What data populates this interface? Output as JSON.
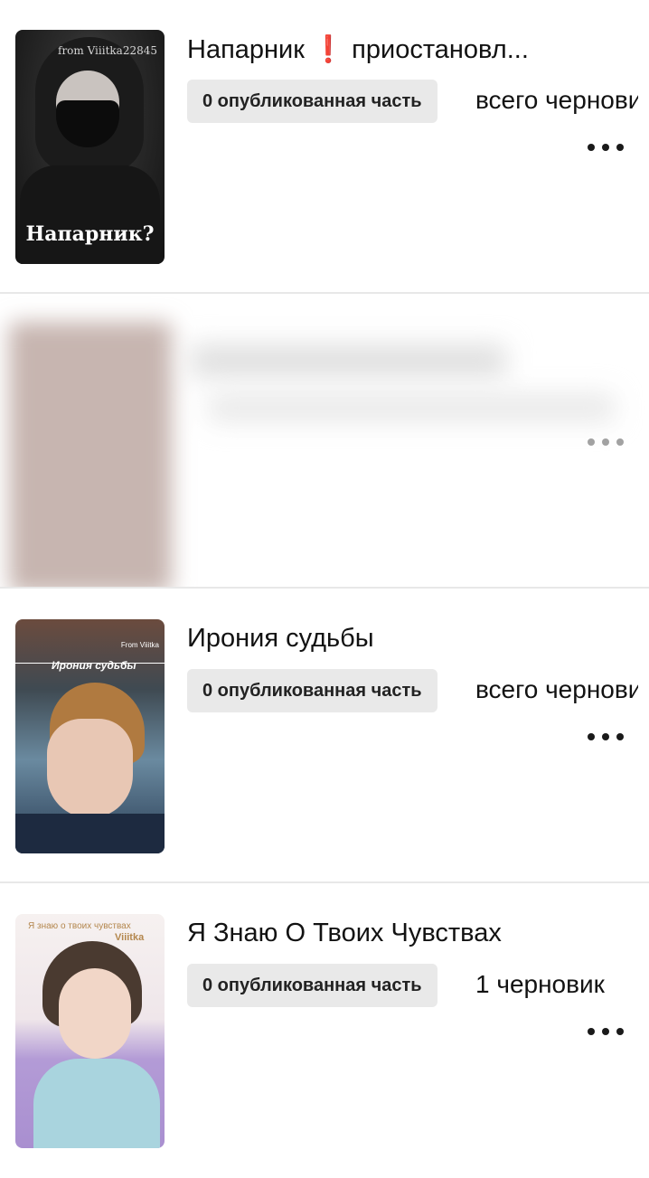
{
  "stories": [
    {
      "title": "Напарник ❗️ приостановл...",
      "published_badge": "0 опубликованная часть",
      "drafts": "всего черновиков",
      "cover": {
        "watermark": "from Viiitka22845",
        "caption": "Напарник?"
      }
    },
    {
      "blurred": true
    },
    {
      "title": "Ирония судьбы",
      "published_badge": "0 опубликованная часть",
      "drafts": "всего черновиков",
      "cover": {
        "watermark": "From Viiitka",
        "caption": "Ирония судьбы"
      }
    },
    {
      "title": "Я Знаю О Твоих Чувствах",
      "published_badge": "0 опубликованная часть",
      "drafts": "1 черновик",
      "cover": {
        "watermark": "Viiitka",
        "caption": "Я знаю о твоих чувствах"
      }
    }
  ],
  "icons": {
    "more": "more-horizontal-icon"
  }
}
